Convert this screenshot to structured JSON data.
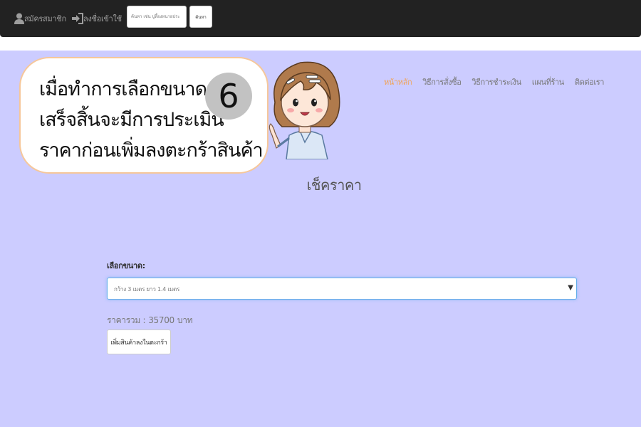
{
  "topbar": {
    "register_label": "สมัครสมาชิก",
    "login_label": "ลงชื่อเข้าใช้",
    "search_placeholder": "ค้นหา เช่น ปูลี้ยงหนายประ",
    "search_button_label": "ค้นหา"
  },
  "menu": {
    "items": [
      {
        "label": "หน้าหลัก",
        "active": true
      },
      {
        "label": "วิธีการสั่งซื้อ",
        "active": false
      },
      {
        "label": "วิธีการชำระเงิน",
        "active": false
      },
      {
        "label": "แผนที่ร้าน",
        "active": false
      },
      {
        "label": "ติดต่อเรา",
        "active": false
      }
    ]
  },
  "callout": {
    "text": "เมื่อทำการเลือกขนาด\nเสร็จสิ้นจะมีการประเมิน\nราคาก่อนเพิ่มลงตะกร้าสินค้า",
    "step_number": "6"
  },
  "page": {
    "title": "เช็คราคา",
    "size_label": "เลือกขนาด:",
    "size_selected": "กว้าง 3 เมตร ยาว 1.4 เมตร",
    "total_label": "ราคารวม :",
    "total_value": "35700",
    "total_unit": "บาท",
    "add_to_cart_label": "เพิ่มสินค้าลงในตะกร้า"
  },
  "colors": {
    "navbar": "#222222",
    "background": "#ccccff",
    "active_menu": "#f0a45a",
    "select_focus": "#66afe9"
  }
}
